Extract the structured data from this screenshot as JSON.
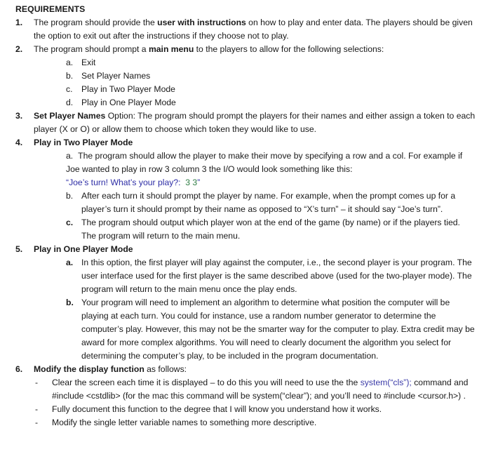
{
  "document": {
    "title": "REQUIREMENTS",
    "colors": {
      "text": "#1a1a1a",
      "background": "#ffffff",
      "code_blue": "#3b3ba8",
      "quote_blue": "#2e2ea6",
      "value_green": "#2f7d45"
    },
    "items": [
      {
        "marker": "1.",
        "text_before_bold": "The program should provide the ",
        "bold": "user with instructions",
        "text_after_bold": " on how to play and enter data. The players should be given the option to exit out after the instructions if they choose not to play."
      },
      {
        "marker": "2.",
        "text_before_bold": "The program should prompt a ",
        "bold": "main menu",
        "text_after_bold": " to the players to allow for the following selections:",
        "subitems": [
          {
            "marker": "a.",
            "text": "Exit"
          },
          {
            "marker": "b.",
            "text": "Set Player Names"
          },
          {
            "marker": "c.",
            "text": "Play in Two Player Mode"
          },
          {
            "marker": "d.",
            "text": "Play in One Player Mode"
          }
        ]
      },
      {
        "marker": "3.",
        "bold": "Set Player Names",
        "text_after_bold": " Option: The program should prompt the players for their names and either assign a token to each player (X or O) or allow them to choose which token they would like to use."
      },
      {
        "marker": "4.",
        "heading": "Play in Two Player Mode",
        "subitems": [
          {
            "marker": "a.",
            "text": "The program should allow the player to make their move by specifying a row and a col. For example if Joe wanted to play in row 3 column 3 the I/O would look something like this:",
            "example_open_quote": "“",
            "example_prompt": "Joe’s turn! What’s your play?:",
            "example_value": "3 3",
            "example_close_quote": "”"
          },
          {
            "marker": "b.",
            "text": "After each turn it should prompt the player by name. For example, when the prompt comes up for a player’s turn it should prompt by their name as opposed to “X’s turn” – it should say “Joe’s turn”."
          },
          {
            "marker": "c.",
            "marker_bold": true,
            "text": "The program should output which player won at the end of the game (by name) or if the players tied.  The program will return to the main menu."
          }
        ]
      },
      {
        "marker": "5.",
        "heading": "Play in One Player Mode",
        "subitems": [
          {
            "marker": "a.",
            "marker_bold": true,
            "text": "In this option, the first player will play against the computer, i.e., the second player is your program. The user interface used for the first player is the same described above (used for the two-player mode). The program will return to the main menu once the play ends."
          },
          {
            "marker": "b.",
            "marker_bold": true,
            "text": "Your program will need to implement an algorithm to determine what position the computer will be playing at each turn. You could for instance, use a random number generator to determine the computer’s play. However, this may not be the smarter way for the computer to play. Extra credit may be award for more complex algorithms. You will need to clearly document the algorithm you select for determining the computer’s play, to be included in the program documentation."
          }
        ]
      },
      {
        "marker": "6.",
        "bold": "Modify the display function",
        "text_after_bold": " as follows:",
        "dash_items": [
          {
            "marker": "-",
            "text_before_code": "Clear the screen each time it is displayed – to do this you will need to use the the ",
            "code": "system(“cls”);",
            "text_after_code": " command  and #include <cstdlib> (for the mac this command will be system(“clear”); and you’ll need to #include <cursor.h>) ."
          },
          {
            "marker": "-",
            "text": "Fully document this function to the degree that I will know you understand how it works."
          },
          {
            "marker": "-",
            "text": "Modify the single letter variable names to something more descriptive."
          }
        ]
      }
    ]
  }
}
